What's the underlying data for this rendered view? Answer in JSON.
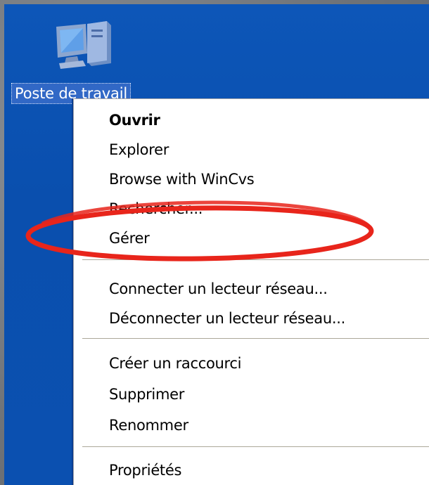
{
  "desktop": {
    "icon_label": "Poste de travail",
    "icon_name": "my-computer-icon",
    "background_color": "#0a4fb0"
  },
  "context_menu": {
    "items": [
      {
        "label": "Ouvrir",
        "default": true
      },
      {
        "label": "Explorer"
      },
      {
        "label": "Browse with WinCvs"
      },
      {
        "label": "Rechercher..."
      },
      {
        "label": "Gérer"
      },
      {
        "label": "Connecter un lecteur réseau..."
      },
      {
        "label": "Déconnecter un lecteur réseau..."
      },
      {
        "label": "Créer un raccourci"
      },
      {
        "label": "Supprimer"
      },
      {
        "label": "Renommer"
      },
      {
        "label": "Propriétés"
      }
    ]
  },
  "annotation": {
    "shape": "ellipse",
    "color": "#e8251b",
    "highlights": "Gérer"
  }
}
